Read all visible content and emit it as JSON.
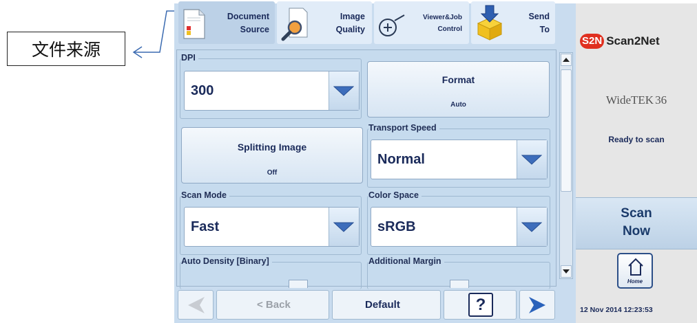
{
  "annotation": {
    "label": "文件来源"
  },
  "tabs": [
    {
      "line1": "Document",
      "line2": "Source",
      "icon": "document-icon",
      "active": true
    },
    {
      "line1": "Image",
      "line2": "Quality",
      "icon": "magnifier-icon",
      "active": false
    },
    {
      "line1": "Viewer&Job",
      "line2": "Control",
      "icon": "zoom-in-icon",
      "active": false
    },
    {
      "line1": "Send",
      "line2": "To",
      "icon": "send-box-icon",
      "active": false
    }
  ],
  "settings": {
    "dpi": {
      "label": "DPI",
      "value": "300"
    },
    "format": {
      "title": "Format",
      "value": "Auto"
    },
    "splitting": {
      "title": "Splitting Image",
      "value": "Off"
    },
    "transport_speed": {
      "label": "Transport Speed",
      "value": "Normal"
    },
    "scan_mode": {
      "label": "Scan Mode",
      "value": "Fast"
    },
    "color_space": {
      "label": "Color Space",
      "value": "sRGB"
    },
    "auto_density": {
      "label": "Auto Density [Binary]"
    },
    "additional_margin": {
      "label": "Additional Margin"
    }
  },
  "nav": {
    "back_label": "< Back",
    "default_label": "Default",
    "help_label": "?"
  },
  "right_panel": {
    "brand": "Scan2Net",
    "brand_logo_text": "S2N",
    "model_name": "WideTEK",
    "model_number": "36",
    "status": "Ready to scan",
    "scan_line1": "Scan",
    "scan_line2": "Now",
    "home_label": "Home",
    "datetime": "12 Nov 2014 12:23:53"
  },
  "colors": {
    "panel_bg": "#c6dbee",
    "accent_blue": "#3d6dbb",
    "text_navy": "#1a2a5a",
    "logo_red": "#e03020"
  }
}
